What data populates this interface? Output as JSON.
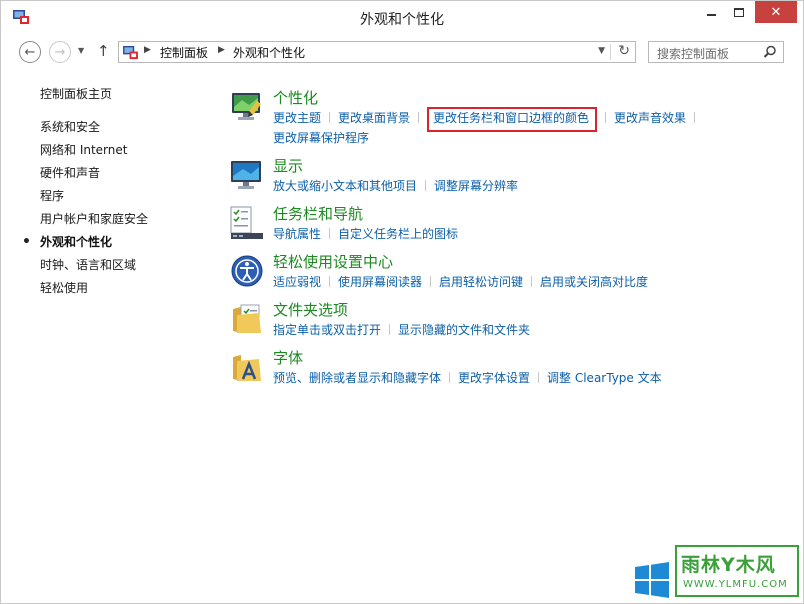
{
  "window": {
    "title": "外观和个性化"
  },
  "nav": {
    "breadcrumb": [
      "控制面板",
      "外观和个性化"
    ],
    "search_placeholder": "搜索控制面板"
  },
  "sidebar": {
    "home": "控制面板主页",
    "items": [
      {
        "label": "系统和安全",
        "active": false
      },
      {
        "label": "网络和 Internet",
        "active": false
      },
      {
        "label": "硬件和声音",
        "active": false
      },
      {
        "label": "程序",
        "active": false
      },
      {
        "label": "用户帐户和家庭安全",
        "active": false
      },
      {
        "label": "外观和个性化",
        "active": true
      },
      {
        "label": "时钟、语言和区域",
        "active": false
      },
      {
        "label": "轻松使用",
        "active": false
      }
    ]
  },
  "categories": [
    {
      "title": "个性化",
      "icon": "personalization-icon",
      "links": [
        "更改主题",
        "更改桌面背景",
        "更改任务栏和窗口边框的颜色",
        "更改声音效果",
        "更改屏幕保护程序"
      ],
      "highlighted_link": "更改任务栏和窗口边框的颜色"
    },
    {
      "title": "显示",
      "icon": "display-icon",
      "links": [
        "放大或缩小文本和其他项目",
        "调整屏幕分辨率"
      ]
    },
    {
      "title": "任务栏和导航",
      "icon": "taskbar-icon",
      "links": [
        "导航属性",
        "自定义任务栏上的图标"
      ]
    },
    {
      "title": "轻松使用设置中心",
      "icon": "ease-of-access-icon",
      "links": [
        "适应弱视",
        "使用屏幕阅读器",
        "启用轻松访问键",
        "启用或关闭高对比度"
      ]
    },
    {
      "title": "文件夹选项",
      "icon": "folder-options-icon",
      "links": [
        "指定单击或双击打开",
        "显示隐藏的文件和文件夹"
      ]
    },
    {
      "title": "字体",
      "icon": "fonts-icon",
      "links": [
        "预览、删除或者显示和隐藏字体",
        "更改字体设置",
        "调整 ClearType 文本"
      ]
    }
  ],
  "watermark": {
    "title": "雨林Y木风",
    "url": "WWW.YLMFU.COM"
  },
  "colors": {
    "category_title": "#1c8a20",
    "link": "#0d5fa8",
    "highlight_border": "#d7262b",
    "close_button": "#c7423f",
    "watermark": "#3aa039"
  }
}
